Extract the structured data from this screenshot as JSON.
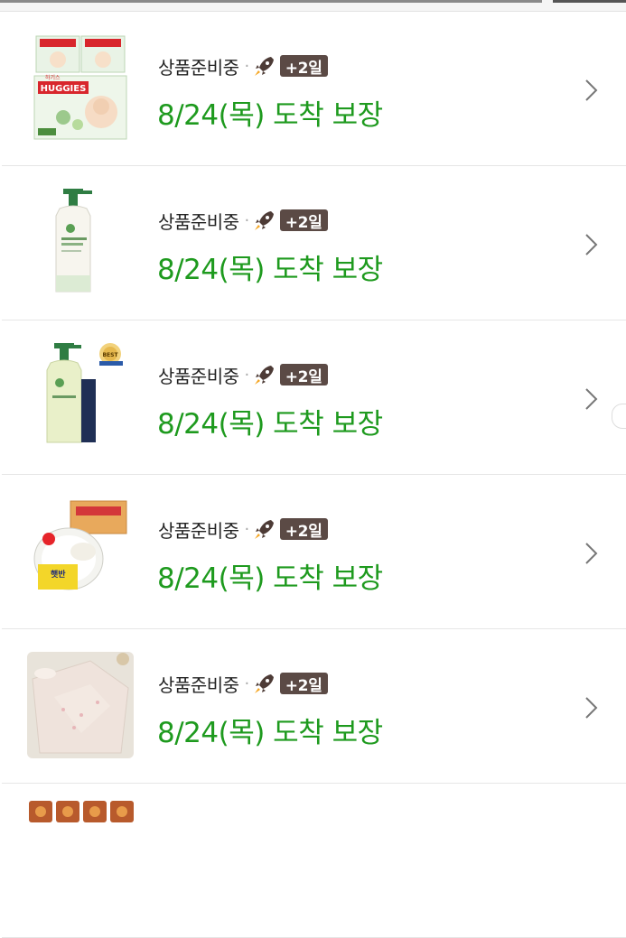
{
  "orders": {
    "status_label": "상품준비중",
    "badge_text": "+2일",
    "delivery_text": "8/24(목) 도착 보장",
    "items": [
      {
        "product": "HUGGIES diapers",
        "status": "상품준비중",
        "badge": "+2일",
        "delivery": "8/24(목) 도착 보장"
      },
      {
        "product": "Baby lotion pump bottle",
        "status": "상품준비중",
        "badge": "+2일",
        "delivery": "8/24(목) 도착 보장"
      },
      {
        "product": "Baby wash pump bottle (BEST)",
        "status": "상품준비중",
        "badge": "+2일",
        "delivery": "8/24(목) 도착 보장"
      },
      {
        "product": "Instant rice bowls box",
        "status": "상품준비중",
        "badge": "+2일",
        "delivery": "8/24(목) 도착 보장"
      },
      {
        "product": "Quilted baby blanket",
        "status": "상품준비중",
        "badge": "+2일",
        "delivery": "8/24(목) 도착 보장"
      }
    ]
  },
  "product_labels": {
    "huggies_brand": "HUGGIES",
    "huggies_kr": "하기스",
    "best_badge": "BEST",
    "rice_label": "햇반"
  },
  "colors": {
    "delivery_green": "#1e9a1e",
    "badge_brown": "#5b4a45",
    "divider": "#e6e6e6"
  },
  "icons": [
    "rocket-icon",
    "chevron-right-icon"
  ]
}
